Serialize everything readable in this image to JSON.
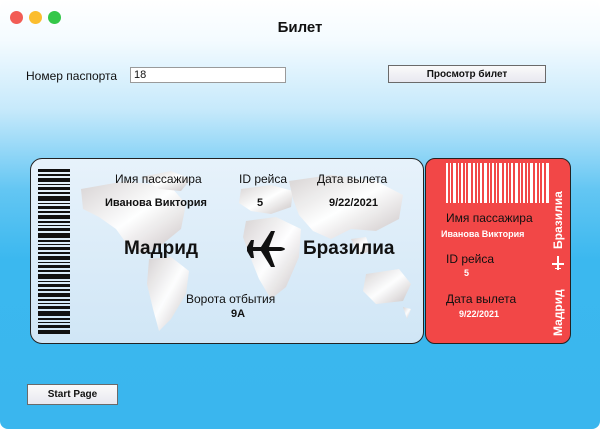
{
  "window": {
    "title": "Билет"
  },
  "form": {
    "passport_label": "Номер паспорта",
    "passport_value": "18",
    "view_button": "Просмотр билет",
    "start_button": "Start Page"
  },
  "ticket": {
    "passenger_label": "Имя пассажира",
    "passenger_name": "Иванова  Виктория",
    "flight_id_label": "ID рейса",
    "flight_id": "5",
    "departure_label": "Дата вылета",
    "departure_date": "9/22/2021",
    "from_city": "Мадрид",
    "to_city": "Бразилиа",
    "gate_label": "Ворота отбытия",
    "gate": "9A"
  },
  "stub": {
    "passenger_label": "Имя пассажира",
    "passenger_name": "Иванова  Виктория",
    "flight_id_label": "ID рейса",
    "flight_id": "5",
    "departure_label": "Дата вылета",
    "departure_date": "9/22/2021",
    "route_to": "Бразилиа",
    "route_from": "Мадрид"
  },
  "colors": {
    "stub_bg": "#f24747",
    "window_gradient_bottom": "#3ab6ee"
  }
}
